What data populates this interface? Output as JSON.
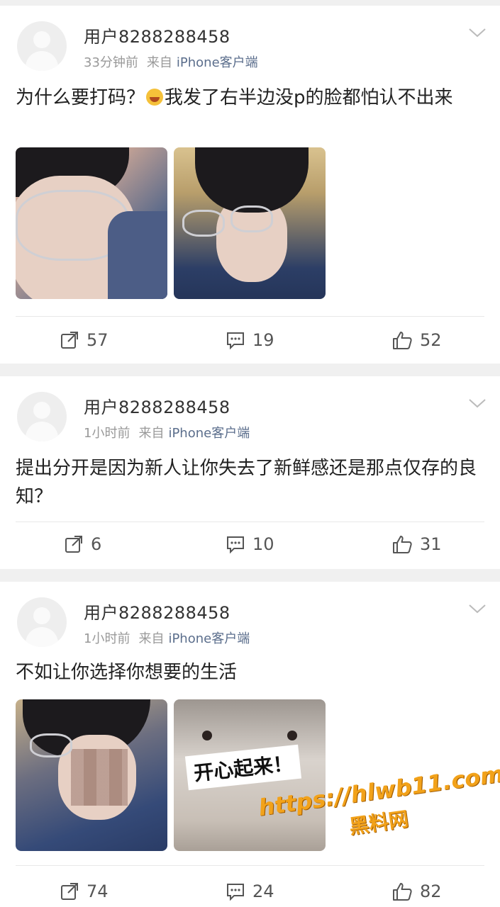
{
  "posts": [
    {
      "username": "用户8288288458",
      "time": "33分钟前",
      "source_label": "来自",
      "source_device": "iPhone客户端",
      "content_before_emoji": "为什么要打码？",
      "content_emoji": "laughing-tears-emoji",
      "content_after_emoji": "我发了右半边没p的脸都怕认不出来",
      "images": [
        "photo-glasses-closeup",
        "photo-selfie-glasses"
      ],
      "reposts": "57",
      "comments": "19",
      "likes": "52"
    },
    {
      "username": "用户8288288458",
      "time": "1小时前",
      "source_label": "来自",
      "source_device": "iPhone客户端",
      "content": "提出分开是因为新人让你失去了新鲜感还是那点仅存的良知？",
      "reposts": "6",
      "comments": "10",
      "likes": "31"
    },
    {
      "username": "用户8288288458",
      "time": "1小时前",
      "source_label": "来自",
      "source_device": "iPhone客户端",
      "content": "不如让你选择你想要的生活",
      "images": [
        "photo-blurred-face",
        "photo-plush-sticker"
      ],
      "sticker_text": "开心起来！",
      "reposts": "74",
      "comments": "24",
      "likes": "82"
    }
  ],
  "icons": {
    "repost": "repost-icon",
    "comment": "comment-icon",
    "like": "thumbs-up-icon",
    "menu": "chevron-down-icon"
  },
  "watermark": {
    "url": "https://hlwb11.com",
    "name": "黑料网"
  },
  "colors": {
    "background": "#f0f0f0",
    "card": "#ffffff",
    "meta_text": "#999999",
    "source_device": "#5b6e8c",
    "watermark": "#f2a21a"
  }
}
